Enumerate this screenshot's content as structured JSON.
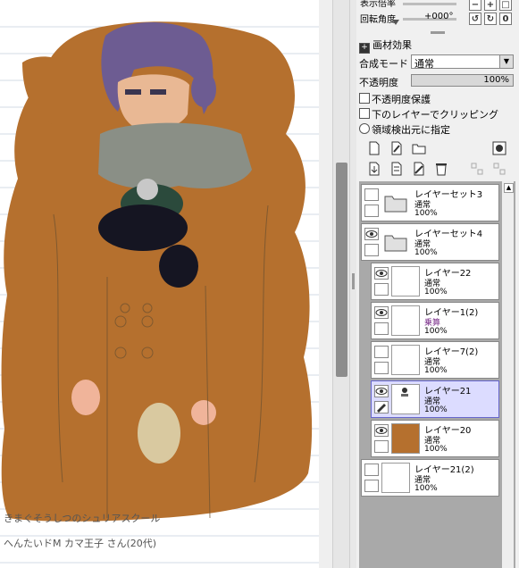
{
  "canvas": {
    "caption_line1": "きまぐそうしつのシュリアスクール",
    "caption_line2": "へんたいドM カマ王子 さん(20代)"
  },
  "top_sliders": {
    "scale_label": "表示倍率",
    "rotation_label": "回転角度",
    "rotation_value": "+000°"
  },
  "material_effects": {
    "title": "画材効果"
  },
  "blend": {
    "label": "合成モード",
    "value": "通常"
  },
  "opacity": {
    "label": "不透明度",
    "value": "100%"
  },
  "options": [
    {
      "label": "不透明度保護",
      "type": "checkbox"
    },
    {
      "label": "下のレイヤーでクリッピング",
      "type": "checkbox"
    },
    {
      "label": "領域検出元に指定",
      "type": "radio"
    }
  ],
  "toolbar_icons": [
    "new-layer-icon",
    "new-linework-icon",
    "new-folder-icon",
    "mask-icon",
    "transfer-down-icon",
    "merge-down-icon",
    "clear-layer-icon",
    "delete-layer-icon",
    "layer-set-icon-a",
    "layer-set-icon-b"
  ],
  "layers": [
    {
      "name": "レイヤーセット3",
      "mode": "通常",
      "opacity": "100%",
      "folder": true,
      "visible": false,
      "selected": false,
      "indent": false
    },
    {
      "name": "レイヤーセット4",
      "mode": "通常",
      "opacity": "100%",
      "folder": true,
      "visible": true,
      "selected": false,
      "indent": false
    },
    {
      "name": "レイヤー22",
      "mode": "通常",
      "opacity": "100%",
      "folder": false,
      "visible": true,
      "selected": false,
      "indent": true
    },
    {
      "name": "レイヤー1(2)",
      "mode": "乗算",
      "opacity": "100%",
      "folder": false,
      "visible": true,
      "selected": false,
      "indent": true
    },
    {
      "name": "レイヤー7(2)",
      "mode": "通常",
      "opacity": "100%",
      "folder": false,
      "visible": false,
      "selected": false,
      "indent": true
    },
    {
      "name": "レイヤー21",
      "mode": "通常",
      "opacity": "100%",
      "folder": false,
      "visible": true,
      "selected": true,
      "indent": true
    },
    {
      "name": "レイヤー20",
      "mode": "通常",
      "opacity": "100%",
      "folder": false,
      "visible": true,
      "selected": false,
      "indent": true
    },
    {
      "name": "レイヤー21(2)",
      "mode": "通常",
      "opacity": "100%",
      "folder": false,
      "visible": false,
      "selected": false,
      "indent": false
    }
  ],
  "colors": {
    "coat": "#b5702e",
    "hair": "#6d5c92",
    "scarf": "#8a8f86",
    "selected_layer": "#dcdcff",
    "multiply_mode": "#7a2e8a"
  }
}
